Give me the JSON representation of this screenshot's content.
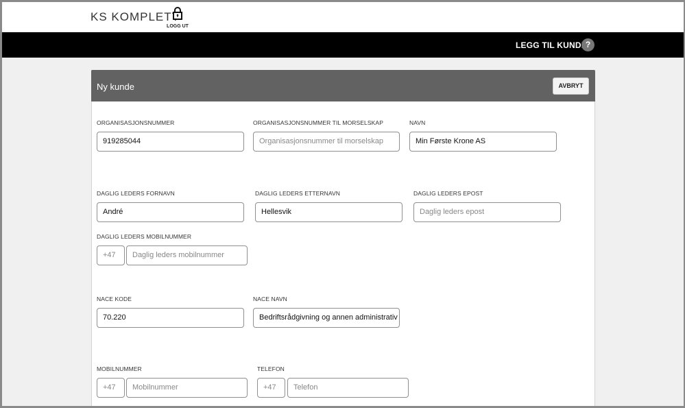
{
  "header": {
    "logo": "KS KOMPLETT",
    "logout_label": "LOGG UT",
    "nav_action": "LEGG TIL KUNDE",
    "help": "?"
  },
  "card": {
    "title": "Ny kunde",
    "cancel_label": "AVBRYT"
  },
  "fields": {
    "orgnr": {
      "label": "ORGANISASJONSNUMMER",
      "value": "919285044"
    },
    "parent_orgnr": {
      "label": "ORGANISASJONSNUMMER TIL MORSELSKAP",
      "placeholder": "Organisasjonsnummer til morselskap"
    },
    "name": {
      "label": "NAVN",
      "value": "Min Første Krone AS"
    },
    "ceo_first": {
      "label": "DAGLIG LEDERS FORNAVN",
      "value": "André"
    },
    "ceo_last": {
      "label": "DAGLIG LEDERS ETTERNAVN",
      "value": "Hellesvik"
    },
    "ceo_email": {
      "label": "DAGLIG LEDERS EPOST",
      "placeholder": "Daglig leders epost"
    },
    "ceo_mobile": {
      "label": "DAGLIG LEDERS MOBILNUMMER",
      "prefix": "+47",
      "placeholder": "Daglig leders mobilnummer"
    },
    "nace_code": {
      "label": "NACE KODE",
      "value": "70.220"
    },
    "nace_name": {
      "label": "NACE NAVN",
      "value": "Bedriftsrådgivning og annen administrativ rådgivning"
    },
    "mobile": {
      "label": "MOBILNUMMER",
      "prefix": "+47",
      "placeholder": "Mobilnummer"
    },
    "phone": {
      "label": "TELEFON",
      "prefix": "+47",
      "placeholder": "Telefon"
    }
  }
}
